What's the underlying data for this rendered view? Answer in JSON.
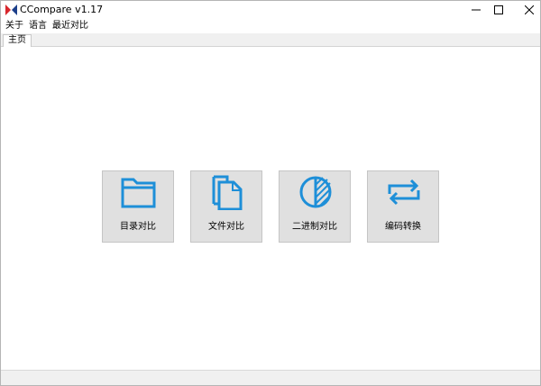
{
  "window": {
    "title": "CCompare  v1.17",
    "controls": {
      "minimize": "minimize",
      "maximize": "maximize",
      "close": "close"
    }
  },
  "menu": {
    "items": [
      "关于",
      "语言",
      "最近对比"
    ]
  },
  "tabs": [
    {
      "label": "主页",
      "selected": true
    }
  ],
  "tiles": [
    {
      "label": "目录对比",
      "icon": "folder-icon"
    },
    {
      "label": "文件对比",
      "icon": "files-icon"
    },
    {
      "label": "二进制对比",
      "icon": "binary-circle-icon"
    },
    {
      "label": "编码转换",
      "icon": "convert-arrows-icon"
    }
  ],
  "colors": {
    "accent": "#1e8fd8",
    "tile_bg": "#e0e0e0",
    "logo_red": "#d8262c",
    "logo_blue": "#1c3f8a"
  }
}
